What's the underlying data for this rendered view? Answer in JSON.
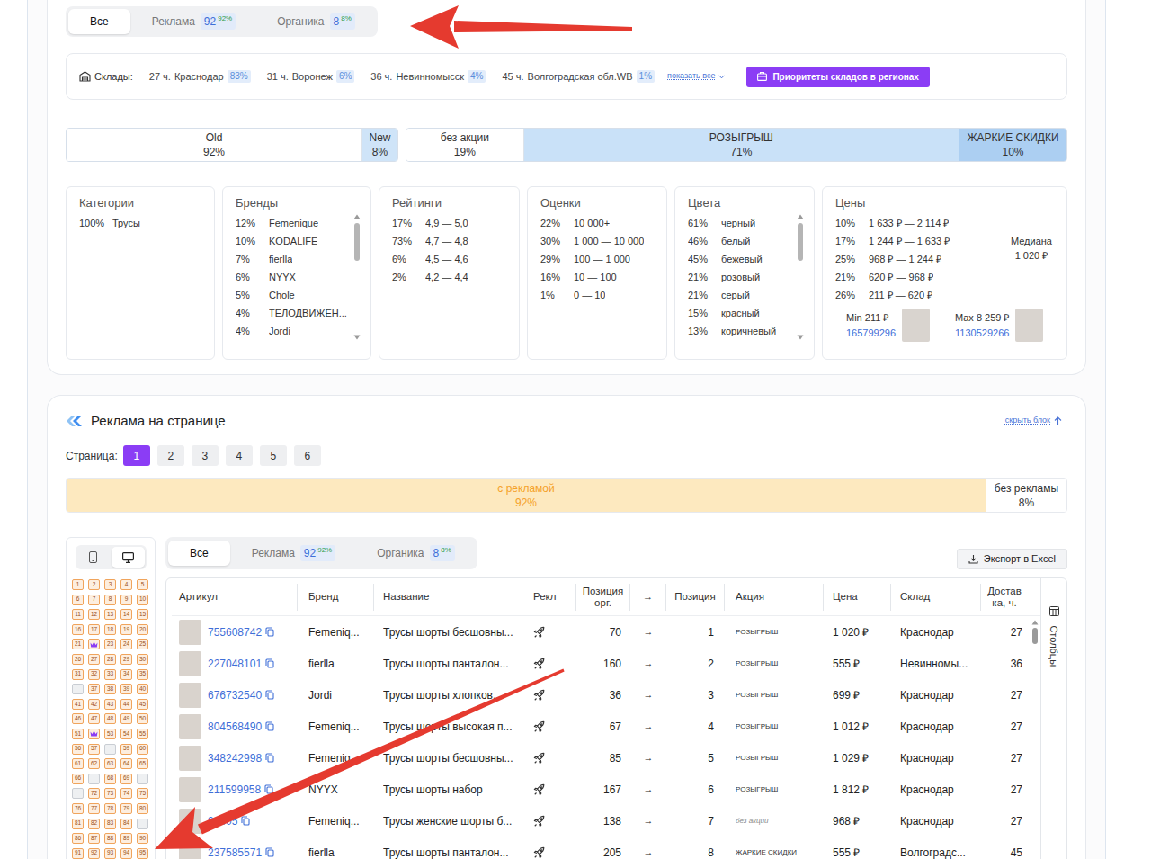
{
  "top_tabs": [
    {
      "label": "Все",
      "selected": true
    },
    {
      "label": "Реклама",
      "count": "92",
      "percent": "92%",
      "selected": false
    },
    {
      "label": "Органика",
      "count": "8",
      "percent": "8%",
      "selected": false
    }
  ],
  "warehouses": {
    "label": "Склады:",
    "items": [
      {
        "hours": "27 ч.",
        "name": "Краснодар",
        "percent": "83%"
      },
      {
        "hours": "31 ч.",
        "name": "Воронеж",
        "percent": "6%"
      },
      {
        "hours": "36 ч.",
        "name": "Невинномысск",
        "percent": "4%"
      },
      {
        "hours": "45 ч.",
        "name": "Волгоградская обл.WB",
        "percent": "1%"
      }
    ],
    "show_all": "показать все",
    "priority_button": "Приоритеты складов в регионах"
  },
  "age_bar": [
    {
      "label": "Old",
      "percent": "92%",
      "level": 0.92,
      "color": "#ffffff"
    },
    {
      "label": "New",
      "percent": "8%",
      "level": 0.08,
      "color": "#cfe4f8"
    }
  ],
  "promo_bar": [
    {
      "label": "без акции",
      "percent": "19%",
      "level": 0.19,
      "color": "#ffffff"
    },
    {
      "label": "РОЗЫГРЫШ",
      "percent": "71%",
      "level": 0.71,
      "color": "#c9e1f8"
    },
    {
      "label": "ЖАРКИЕ СКИДКИ",
      "percent": "10%",
      "level": 0.1,
      "color": "#accff2"
    }
  ],
  "stats": {
    "categories": {
      "title": "Категории",
      "rows": [
        {
          "percent": "100%",
          "label": "Трусы"
        }
      ]
    },
    "brands": {
      "title": "Бренды",
      "rows": [
        {
          "percent": "12%",
          "label": "Femenique"
        },
        {
          "percent": "10%",
          "label": "KODALIFE"
        },
        {
          "percent": "7%",
          "label": "fierlla"
        },
        {
          "percent": "6%",
          "label": "NYYX"
        },
        {
          "percent": "5%",
          "label": "Chole"
        },
        {
          "percent": "4%",
          "label": "ТЕЛОДВИЖЕН..."
        },
        {
          "percent": "4%",
          "label": "Jordi"
        }
      ]
    },
    "ratings": {
      "title": "Рейтинги",
      "rows": [
        {
          "percent": "17%",
          "label": "4,9 — 5,0"
        },
        {
          "percent": "73%",
          "label": "4,7 — 4,8"
        },
        {
          "percent": "6%",
          "label": "4,5 — 4,6"
        },
        {
          "percent": "2%",
          "label": "4,2 — 4,4"
        }
      ]
    },
    "reviews": {
      "title": "Оценки",
      "rows": [
        {
          "percent": "22%",
          "label": "10 000+"
        },
        {
          "percent": "30%",
          "label": "1 000 — 10 000"
        },
        {
          "percent": "29%",
          "label": "100 — 1 000"
        },
        {
          "percent": "16%",
          "label": "10 — 100"
        },
        {
          "percent": "1%",
          "label": "0 — 10"
        }
      ]
    },
    "colors": {
      "title": "Цвета",
      "rows": [
        {
          "percent": "61%",
          "label": "черный"
        },
        {
          "percent": "46%",
          "label": "белый"
        },
        {
          "percent": "45%",
          "label": "бежевый"
        },
        {
          "percent": "21%",
          "label": "розовый"
        },
        {
          "percent": "21%",
          "label": "серый"
        },
        {
          "percent": "15%",
          "label": "красный"
        },
        {
          "percent": "13%",
          "label": "коричневый"
        }
      ]
    },
    "prices": {
      "title": "Цены",
      "rows": [
        {
          "percent": "10%",
          "label": "1 633 ₽ — 2 114 ₽"
        },
        {
          "percent": "17%",
          "label": "1 244 ₽ — 1 633 ₽"
        },
        {
          "percent": "25%",
          "label": "968 ₽ — 1 244 ₽"
        },
        {
          "percent": "21%",
          "label": "620 ₽ — 968 ₽"
        },
        {
          "percent": "26%",
          "label": "211 ₽ — 620 ₽"
        }
      ],
      "median_label": "Медиана",
      "median_value": "1 020 ₽",
      "min": {
        "label": "Min 211 ₽",
        "article": "165799296"
      },
      "max": {
        "label": "Max 8 259 ₽",
        "article": "1130529266"
      }
    }
  },
  "ads": {
    "title": "Реклама на странице",
    "hide": "скрыть блок",
    "pages_label": "Страница:",
    "pages": [
      {
        "label": "1",
        "selected": true
      },
      {
        "label": "2",
        "selected": false
      },
      {
        "label": "3",
        "selected": false
      },
      {
        "label": "4",
        "selected": false
      },
      {
        "label": "5",
        "selected": false
      },
      {
        "label": "6",
        "selected": false
      }
    ],
    "share_bar": [
      {
        "label": "с рекламой",
        "percent": "92%",
        "level": 0.92,
        "color": "#fde9bf",
        "kind": "ad"
      },
      {
        "label": "без рекламы",
        "percent": "8%",
        "level": 0.08,
        "color": "#ffffff",
        "kind": "organic"
      }
    ],
    "devices": [
      {
        "kind": "mobile",
        "selected": false
      },
      {
        "kind": "desktop",
        "selected": true
      }
    ],
    "slots": [
      {
        "kind": "ad",
        "label": "1"
      },
      {
        "kind": "ad",
        "label": "2"
      },
      {
        "kind": "ad",
        "label": "3"
      },
      {
        "kind": "ad",
        "label": "4"
      },
      {
        "kind": "ad",
        "label": "5"
      },
      {
        "kind": "ad",
        "label": "6"
      },
      {
        "kind": "ad",
        "label": "7"
      },
      {
        "kind": "ad",
        "label": "8"
      },
      {
        "kind": "ad",
        "label": "9"
      },
      {
        "kind": "ad",
        "label": "10"
      },
      {
        "kind": "ad",
        "label": "11"
      },
      {
        "kind": "ad",
        "label": "12"
      },
      {
        "kind": "ad",
        "label": "13"
      },
      {
        "kind": "ad",
        "label": "14"
      },
      {
        "kind": "ad",
        "label": "15"
      },
      {
        "kind": "ad",
        "label": "16"
      },
      {
        "kind": "ad",
        "label": "17"
      },
      {
        "kind": "ad",
        "label": "18"
      },
      {
        "kind": "ad",
        "label": "19"
      },
      {
        "kind": "ad",
        "label": "20"
      },
      {
        "kind": "ad",
        "label": "21"
      },
      {
        "kind": "top"
      },
      {
        "kind": "ad",
        "label": "23"
      },
      {
        "kind": "ad",
        "label": "24"
      },
      {
        "kind": "ad",
        "label": "25"
      },
      {
        "kind": "ad",
        "label": "26"
      },
      {
        "kind": "ad",
        "label": "27"
      },
      {
        "kind": "ad",
        "label": "28"
      },
      {
        "kind": "ad",
        "label": "29"
      },
      {
        "kind": "ad",
        "label": "30"
      },
      {
        "kind": "ad",
        "label": "31"
      },
      {
        "kind": "ad",
        "label": "32"
      },
      {
        "kind": "ad",
        "label": "33"
      },
      {
        "kind": "ad",
        "label": "34"
      },
      {
        "kind": "ad",
        "label": "35"
      },
      {
        "kind": "organic"
      },
      {
        "kind": "ad",
        "label": "37"
      },
      {
        "kind": "ad",
        "label": "38"
      },
      {
        "kind": "ad",
        "label": "39"
      },
      {
        "kind": "ad",
        "label": "40"
      },
      {
        "kind": "ad",
        "label": "41"
      },
      {
        "kind": "ad",
        "label": "42"
      },
      {
        "kind": "ad",
        "label": "43"
      },
      {
        "kind": "ad",
        "label": "44"
      },
      {
        "kind": "ad",
        "label": "45"
      },
      {
        "kind": "ad",
        "label": "46"
      },
      {
        "kind": "ad",
        "label": "47"
      },
      {
        "kind": "ad",
        "label": "48"
      },
      {
        "kind": "ad",
        "label": "49"
      },
      {
        "kind": "ad",
        "label": "50"
      },
      {
        "kind": "ad",
        "label": "51"
      },
      {
        "kind": "top"
      },
      {
        "kind": "ad",
        "label": "53"
      },
      {
        "kind": "ad",
        "label": "54"
      },
      {
        "kind": "ad",
        "label": "55"
      },
      {
        "kind": "ad",
        "label": "56"
      },
      {
        "kind": "ad",
        "label": "57"
      },
      {
        "kind": "organic"
      },
      {
        "kind": "ad",
        "label": "59"
      },
      {
        "kind": "ad",
        "label": "60"
      },
      {
        "kind": "ad",
        "label": "61"
      },
      {
        "kind": "ad",
        "label": "62"
      },
      {
        "kind": "ad",
        "label": "63"
      },
      {
        "kind": "ad",
        "label": "64"
      },
      {
        "kind": "ad",
        "label": "65"
      },
      {
        "kind": "ad",
        "label": "66"
      },
      {
        "kind": "organic"
      },
      {
        "kind": "ad",
        "label": "68"
      },
      {
        "kind": "ad",
        "label": "69"
      },
      {
        "kind": "organic"
      },
      {
        "kind": "organic"
      },
      {
        "kind": "ad",
        "label": "72"
      },
      {
        "kind": "ad",
        "label": "73"
      },
      {
        "kind": "ad",
        "label": "74"
      },
      {
        "kind": "ad",
        "label": "75"
      },
      {
        "kind": "ad",
        "label": "76"
      },
      {
        "kind": "ad",
        "label": "77"
      },
      {
        "kind": "ad",
        "label": "78"
      },
      {
        "kind": "ad",
        "label": "79"
      },
      {
        "kind": "ad",
        "label": "80"
      },
      {
        "kind": "ad",
        "label": "81"
      },
      {
        "kind": "ad",
        "label": "82"
      },
      {
        "kind": "ad",
        "label": "83"
      },
      {
        "kind": "ad",
        "label": "84"
      },
      {
        "kind": "organic"
      },
      {
        "kind": "ad",
        "label": "86"
      },
      {
        "kind": "ad",
        "label": "87"
      },
      {
        "kind": "ad",
        "label": "88"
      },
      {
        "kind": "ad",
        "label": "89"
      },
      {
        "kind": "ad",
        "label": "90"
      },
      {
        "kind": "ad",
        "label": "91"
      },
      {
        "kind": "ad",
        "label": "92"
      },
      {
        "kind": "ad",
        "label": "93"
      },
      {
        "kind": "ad",
        "label": "94"
      },
      {
        "kind": "ad",
        "label": "95"
      }
    ]
  },
  "table": {
    "tabs": [
      {
        "label": "Все",
        "selected": true
      },
      {
        "label": "Реклама",
        "count": "92",
        "percent": "92%",
        "selected": false
      },
      {
        "label": "Органика",
        "count": "8",
        "percent": "8%",
        "selected": false
      }
    ],
    "export": "Экспорт в Excel",
    "columns_button": "Столбцы",
    "columns": [
      "Артикул",
      "Бренд",
      "Название",
      "Рекл",
      "Позиция орг.",
      "→",
      "Позиция",
      "Акция",
      "Цена",
      "Склад",
      "Доставка, ч."
    ],
    "rows": [
      {
        "article": "755608742",
        "brand": "Femeniq...",
        "name": "Трусы шорты бесшовны...",
        "advertised": true,
        "organic_position": "70",
        "arrow": "→",
        "position": "1",
        "promo": {
          "label": "РОЗЫГРЫШ",
          "active": true
        },
        "price": "1 020 ₽",
        "warehouse": "Краснодар",
        "delivery": "27"
      },
      {
        "article": "227048101",
        "brand": "fierlla",
        "name": "Трусы шорты панталон...",
        "advertised": true,
        "organic_position": "160",
        "arrow": "→",
        "position": "2",
        "promo": {
          "label": "РОЗЫГРЫШ",
          "active": true
        },
        "price": "555 ₽",
        "warehouse": "Невинномы...",
        "delivery": "36"
      },
      {
        "article": "676732540",
        "brand": "Jordi",
        "name": "Трусы шорты хлопков...",
        "advertised": true,
        "organic_position": "36",
        "arrow": "→",
        "position": "3",
        "promo": {
          "label": "РОЗЫГРЫШ",
          "active": true
        },
        "price": "699 ₽",
        "warehouse": "Краснодар",
        "delivery": "27"
      },
      {
        "article": "804568490",
        "brand": "Femeniq...",
        "name": "Трусы шорты высокая п...",
        "advertised": true,
        "organic_position": "67",
        "arrow": "→",
        "position": "4",
        "promo": {
          "label": "РОЗЫГРЫШ",
          "active": true
        },
        "price": "1 012 ₽",
        "warehouse": "Краснодар",
        "delivery": "27"
      },
      {
        "article": "348242998",
        "brand": "Femeniq...",
        "name": "Трусы шорты бесшовны...",
        "advertised": true,
        "organic_position": "85",
        "arrow": "→",
        "position": "5",
        "promo": {
          "label": "РОЗЫГРЫШ",
          "active": true
        },
        "price": "1 029 ₽",
        "warehouse": "Краснодар",
        "delivery": "27"
      },
      {
        "article": "211599958",
        "brand": "NYYX",
        "name": "Трусы шорты набор",
        "advertised": true,
        "organic_position": "167",
        "arrow": "→",
        "position": "6",
        "promo": {
          "label": "РОЗЫГРЫШ",
          "active": true
        },
        "price": "1 812 ₽",
        "warehouse": "Краснодар",
        "delivery": "27"
      },
      {
        "article": "94405",
        "brand": "Femeniq...",
        "name": "Трусы женские шорты б...",
        "advertised": true,
        "organic_position": "138",
        "arrow": "→",
        "position": "7",
        "promo": {
          "label": "без акции",
          "active": false
        },
        "price": "968 ₽",
        "warehouse": "Краснодар",
        "delivery": "27"
      },
      {
        "article": "237585571",
        "brand": "fierlla",
        "name": "Трусы шорты панталон...",
        "advertised": true,
        "organic_position": "205",
        "arrow": "→",
        "position": "8",
        "promo": {
          "label": "ЖАРКИЕ СКИДКИ",
          "active": true
        },
        "price": "555 ₽",
        "warehouse": "Волгоградс...",
        "delivery": "45"
      }
    ]
  }
}
